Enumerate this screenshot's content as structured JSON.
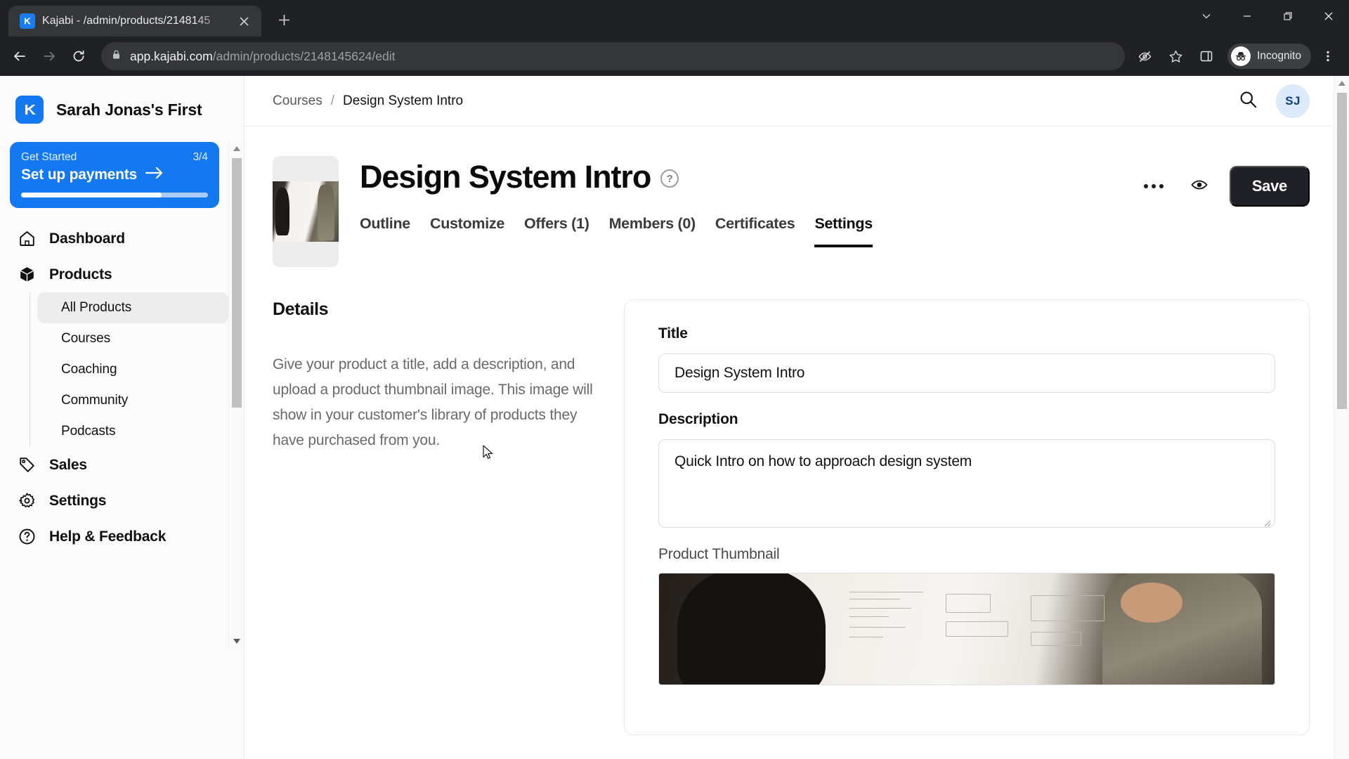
{
  "browser": {
    "tab": {
      "title": "Kajabi - /admin/products/2148145",
      "favicon": "kajabi-logo-icon",
      "close": "×"
    },
    "new_tab_label": "+",
    "window_controls": [
      "chevron-down-icon",
      "minimize-icon",
      "maximize-icon",
      "close-icon"
    ],
    "nav": {
      "back": "back-arrow-icon",
      "forward": "forward-arrow-icon",
      "reload": "reload-icon"
    },
    "omnibox": {
      "lock": "lock-icon",
      "url_host": "app.kajabi.com",
      "url_path": "/admin/products/2148145624/edit",
      "full_url": "app.kajabi.com/admin/products/2148145624/edit"
    },
    "toolbar_right": {
      "tracking_protection": "eye-slash-icon",
      "bookmark": "star-icon",
      "side_panel": "side-panel-icon",
      "incognito_label": "Incognito",
      "incognito_avatar": "incognito-hat-icon",
      "menu": "three-dots-vertical-icon"
    }
  },
  "sidebar": {
    "brand": {
      "name": "Sarah Jonas's First",
      "logo": "kajabi-logo-icon"
    },
    "get_started": {
      "label": "Get Started",
      "count": "3/4",
      "title": "Set up payments",
      "arrow": "arrow-right-icon",
      "progress_percent": 75,
      "accent_color": "#1478f0"
    },
    "items": [
      {
        "label": "Dashboard",
        "icon": "home-icon"
      },
      {
        "label": "Products",
        "icon": "cube-icon"
      },
      {
        "label": "Sales",
        "icon": "tag-icon"
      },
      {
        "label": "Settings",
        "icon": "gear-icon"
      },
      {
        "label": "Help & Feedback",
        "icon": "question-circle-icon"
      }
    ],
    "product_subitems": [
      {
        "label": "All Products",
        "active": true
      },
      {
        "label": "Courses",
        "active": false
      },
      {
        "label": "Coaching",
        "active": false
      },
      {
        "label": "Community",
        "active": false
      },
      {
        "label": "Podcasts",
        "active": false
      }
    ]
  },
  "topbar": {
    "breadcrumb": {
      "parent": "Courses",
      "separator": "/",
      "current": "Design System Intro"
    },
    "search_icon": "search-icon",
    "avatar_initials": "SJ"
  },
  "product": {
    "title": "Design System Intro",
    "help_icon": "?",
    "thumbnail_alt": "two-people-at-whiteboard-thumbnail",
    "tabs": [
      {
        "label": "Outline",
        "active": false
      },
      {
        "label": "Customize",
        "active": false
      },
      {
        "label": "Offers (1)",
        "active": false
      },
      {
        "label": "Members (0)",
        "active": false
      },
      {
        "label": "Certificates",
        "active": false
      },
      {
        "label": "Settings",
        "active": true
      }
    ],
    "actions": {
      "more_icon": "three-dots-horizontal-icon",
      "preview_icon": "eye-icon",
      "save_label": "Save"
    }
  },
  "details": {
    "section_title": "Details",
    "section_description": "Give your product a title, add a description, and upload a product thumbnail image. This image will show in your customer's library of products they have purchased from you.",
    "fields": {
      "title_label": "Title",
      "title_value": "Design System Intro",
      "title_placeholder": "Title",
      "description_label": "Description",
      "description_value": "Quick Intro on how to approach design system",
      "description_placeholder": "Description",
      "thumbnail_label": "Product Thumbnail",
      "thumbnail_alt": "whiteboard-session-image"
    }
  },
  "colors": {
    "accent_blue": "#1478f0",
    "save_dark": "#1f2126",
    "chrome_dark": "#202124",
    "avatar_bg": "#ddeafb"
  }
}
